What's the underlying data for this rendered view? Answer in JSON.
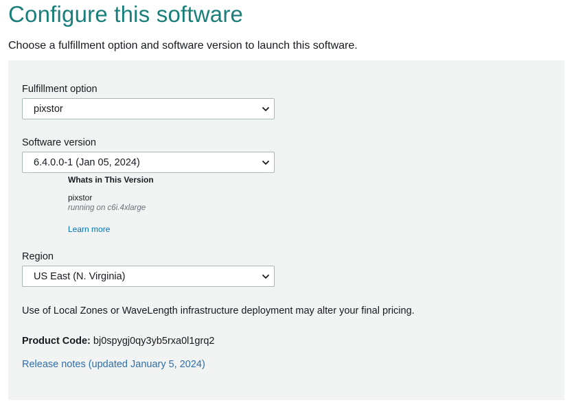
{
  "page": {
    "title": "Configure this software",
    "subtitle": "Choose a fulfillment option and software version to launch this software."
  },
  "fulfillment": {
    "label": "Fulfillment option",
    "selected": "pixstor"
  },
  "software_version": {
    "label": "Software version",
    "selected": "6.4.0.0-1 (Jan 05, 2024)",
    "info_heading": "Whats in This Version",
    "product_name": "pixstor",
    "instance_note": "running on c6i.4xlarge",
    "learn_more": "Learn more"
  },
  "region": {
    "label": "Region",
    "selected": "US East (N. Virginia)"
  },
  "pricing_note": "Use of Local Zones or WaveLength infrastructure deployment may alter your final pricing.",
  "product_code": {
    "label": "Product Code:",
    "value": "bj0spygj0qy3yb5rxa0l1grq2"
  },
  "release_notes": "Release notes (updated January 5, 2024)",
  "colors": {
    "title": "#1a7f7a",
    "link": "#0073bb",
    "panel_bg": "#f2f3f3"
  },
  "icons": {
    "dropdown": "chevron-down-icon"
  }
}
